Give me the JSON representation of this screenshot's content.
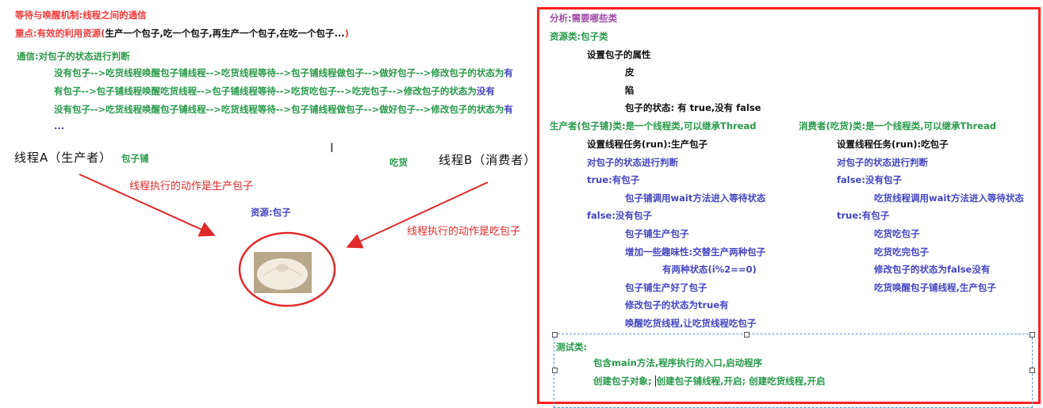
{
  "left": {
    "title": "等待与唤醒机制:线程之间的通信",
    "key_prefix": "重点:有效的利用资源(",
    "key_body": "生产一个包子,吃一个包子,再生产一个包子,在吃一个包子...",
    "key_suffix": ")",
    "comm_title": "通信:对包子的状态进行判断",
    "flow": [
      {
        "text": "没有包子-->吃货线程唤醒包子铺线程-->吃货线程等待-->包子铺线程做包子-->做好包子-->修改包子的状态为",
        "tail": "有"
      },
      {
        "text": "有包子-->包子铺线程唤醒吃货线程-->包子铺线程等待-->吃货吃包子-->吃完包子-->修改包子的状态为",
        "tail": "没有"
      },
      {
        "text": "没有包子-->吃货线程唤醒包子铺线程-->吃货线程等待-->包子铺线程做包子-->做好包子-->修改包子的状态为",
        "tail": "有"
      }
    ],
    "ellipsis": "...",
    "thread_a": "线程A（生产者）",
    "thread_a_tag": "包子铺",
    "thread_b": "线程B（消费者）",
    "thread_b_tag": "吃货",
    "action_a": "线程执行的动作是生产包子",
    "action_b": "线程执行的动作是吃包子",
    "resource": "资源:包子"
  },
  "right": {
    "analysis": "分析:需要哪些类",
    "resource_class": "资源类:包子类",
    "set_attrs": "设置包子的属性",
    "skin": "皮",
    "filling": "陷",
    "state": "包子的状态: 有 true,没有 false",
    "producer": {
      "title": "生产者(包子铺)类:是一个线程类,可以继承Thread",
      "task": "设置线程任务(run):生产包子",
      "judge": "对包子的状态进行判断",
      "true_label": "true:有包子",
      "true_action": "包子铺调用wait方法进入等待状态",
      "false_label": "false:没有包子",
      "steps": [
        "包子铺生产包子",
        "增加一些趣味性:交替生产两种包子",
        "有两种状态(i%2==0)",
        "包子铺生产好了包子",
        "修改包子的状态为true有",
        "唤醒吃货线程,让吃货线程吃包子"
      ]
    },
    "consumer": {
      "title": "消费者(吃货)类:是一个线程类,可以继承Thread",
      "task": "设置线程任务(run):吃包子",
      "judge": "对包子的状态进行判断",
      "false_label": "false:没有包子",
      "false_action": "吃货线程调用wait方法进入等待状态",
      "true_label": "true:有包子",
      "steps": [
        "吃货吃包子",
        "吃货吃完包子",
        "修改包子的状态为false没有",
        "吃货唤醒包子铺线程,生产包子"
      ]
    },
    "test": {
      "title": "测试类:",
      "main": "包含main方法,程序执行的入口,启动程序",
      "create_prefix": "创建包子对象; ",
      "create_rest": "创建包子铺线程,开启; 创建吃货线程,开启"
    }
  }
}
